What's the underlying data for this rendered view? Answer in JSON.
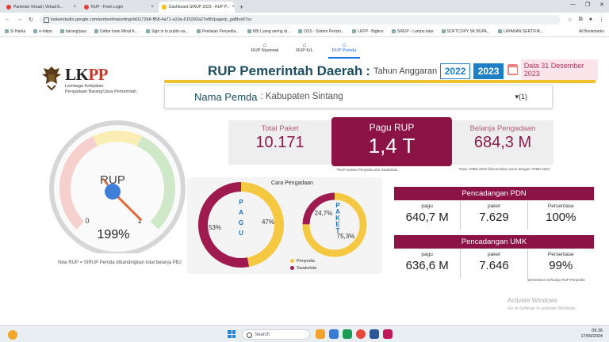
{
  "browser": {
    "tabs": [
      {
        "label": "Pameran Virtual | Virtual E...",
        "color": "#e53935",
        "active": false
      },
      {
        "label": "RUP - Form Login",
        "color": "#e53935",
        "active": false
      },
      {
        "label": "Dashboard SIRUP 2023 - RUP P...",
        "color": "#fbbc04",
        "active": true
      }
    ],
    "new_tab": "+",
    "url": "lookerstudio.google.com/embed/reporting/dd1172b8-ff58-4a71-a10a-615292a27e80/page/p_gaf8xx67sc",
    "bookmarks": [
      "Si Harka",
      "e-Inkpn",
      "barang/jasa",
      "Daftar Isian Minat K...",
      "Sign in to public-sa...",
      "Penilaian Penyedia...",
      "KBLI yang sering di...",
      "OSS - Sistem Perizin...",
      "LKPP - Bigbox",
      "SIRUP - Lampu latar",
      "SOFTCOPY SK BUPA...",
      "LAYANAN SERTIFIK..."
    ],
    "all_bookmarks": "All Bookmarks"
  },
  "nav": {
    "items": [
      {
        "label": "RUP Nasional",
        "active": false
      },
      {
        "label": "RUP K/L",
        "active": false
      },
      {
        "label": "RUP Pemda",
        "active": true
      }
    ]
  },
  "logo": {
    "name_a": "LK",
    "name_b": "PP",
    "line1": "Lembaga Kebijakan",
    "line2": "Pengadaan Barang/Jasa Pemerintah"
  },
  "header": {
    "title": "RUP Pemerintah Daerah",
    "colon": ":",
    "subtitle": "Tahun Anggaran",
    "years": [
      {
        "label": "2022",
        "selected": false
      },
      {
        "label": "2023",
        "selected": true
      }
    ],
    "date": "Data 31 Desember 2023"
  },
  "pemda": {
    "label": "Nama Pemda",
    "value": ": Kabupaten Sintang",
    "selector": "(1)"
  },
  "kpis": {
    "total_paket": {
      "title": "Total Paket",
      "value": "10.171"
    },
    "pagu_rup": {
      "title": "Pagu RUP",
      "value": "1,4 T"
    },
    "belanja": {
      "title": "Belanja Pengadaan",
      "value": "684,3 M"
    },
    "note_rup": "*RUP melalui Penyedia dan Swakelola",
    "note_apbd": "*Data APBD 2023 diasumsikan sama dengan APBD 2022"
  },
  "gauge": {
    "label": "RUP",
    "value_text": "199%",
    "min_label": "0",
    "max_label": "1",
    "value": 1.99,
    "note": "Nilai RUP = SIRUP Pemda dibandingkan total belanja PBJ"
  },
  "cara_pengadaan": {
    "title": "Cara Pengadaan",
    "pagu": {
      "center": "PAGU",
      "penyedia_pct": "47%",
      "swakelola_pct": "53%",
      "penyedia": 47,
      "swakelola": 53
    },
    "paket": {
      "center": "PAKET",
      "penyedia_pct": "75,3%",
      "swakelola_pct": "24,7%",
      "penyedia": 75.3,
      "swakelola": 24.7
    },
    "legend": [
      {
        "label": "Penyedia",
        "color": "#f5c842"
      },
      {
        "label": "Swakelola",
        "color": "#9e1a4f"
      }
    ]
  },
  "pencadangan_pdn": {
    "title": "Pencadangan PDN",
    "cols": [
      {
        "label": "pagu",
        "value": "640,7 M"
      },
      {
        "label": "paket",
        "value": "7.629"
      },
      {
        "label": "Persentase",
        "value": "100%"
      }
    ]
  },
  "pencadangan_umk": {
    "title": "Pencadangan UMK",
    "cols": [
      {
        "label": "pagu",
        "value": "636,6 M"
      },
      {
        "label": "paket",
        "value": "7.646"
      },
      {
        "label": "Persentase",
        "value": "99%"
      }
    ],
    "note": "*persentase terhadap RUP Penyedia"
  },
  "watermark": {
    "line1": "Activate Windows",
    "line2": "Go to Settings to activate Windows."
  },
  "taskbar": {
    "search": "Search",
    "time": "09:36",
    "date": "17/09/2024"
  }
}
